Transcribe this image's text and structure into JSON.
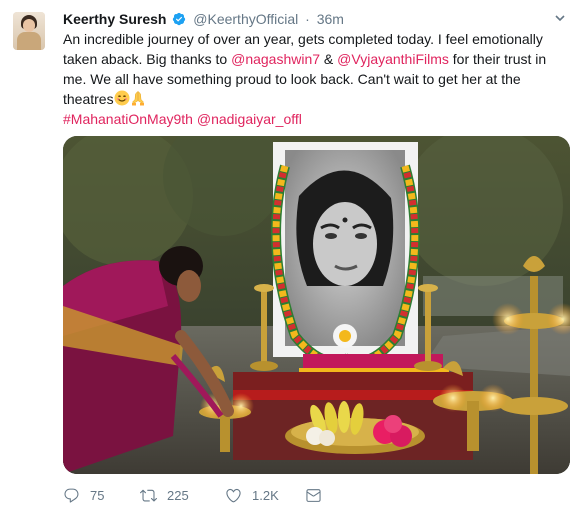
{
  "tweet": {
    "author_name": "Keerthy Suresh",
    "author_handle": "@KeerthyOfficial",
    "separator": "·",
    "timestamp": "36m",
    "text_intro": "An incredible journey of over an year, gets completed today. I feel emotionally taken aback. Big thanks to ",
    "mention_1": "@nagashwin7",
    "text_and": " & ",
    "mention_2": "@VyjayanthiFilms",
    "text_outro": " for their trust in me. We all have something proud to look back. Can't wait to get her at the theatres",
    "hashtag": "#MahanatiOnMay9th",
    "mention_3": "@nadigaiyar_offl",
    "emojis": [
      "smiling-face-icon",
      "folded-hands-icon"
    ]
  },
  "actions": {
    "reply_count": "75",
    "retweet_count": "225",
    "like_count": "1.2K"
  },
  "colors": {
    "accent": "#e0245e",
    "muted": "#657786",
    "verified": "#1da1f2"
  },
  "media": {
    "type": "photo"
  }
}
